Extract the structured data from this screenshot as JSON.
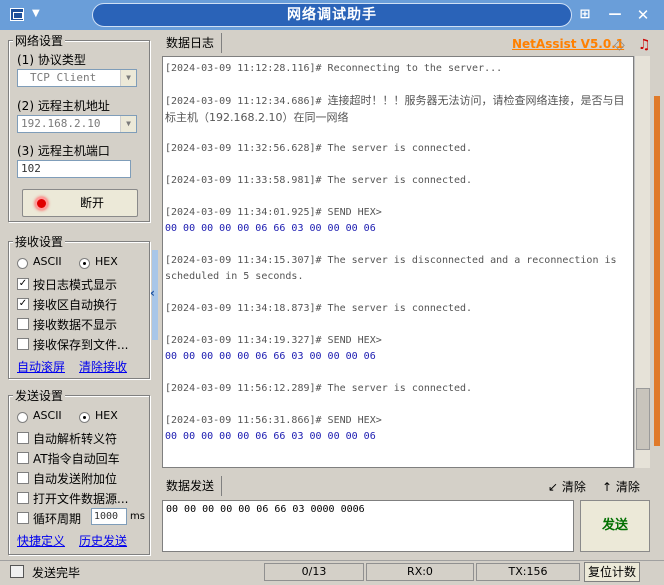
{
  "window": {
    "title": "网络调试助手"
  },
  "header": {
    "log_tab": "数据日志",
    "brand": "NetAssist V5.0.1"
  },
  "network": {
    "title": "网络设置",
    "protocol_label": "(1) 协议类型",
    "protocol_value": "TCP Client",
    "host_label": "(2) 远程主机地址",
    "host_value": "192.168.2.10",
    "port_label": "(3) 远程主机端口",
    "port_value": "102",
    "disconnect_label": "断开"
  },
  "receive": {
    "title": "接收设置",
    "ascii": "ASCII",
    "hex": "HEX",
    "options": [
      {
        "label": "按日志模式显示",
        "checked": true
      },
      {
        "label": "接收区自动换行",
        "checked": true
      },
      {
        "label": "接收数据不显示",
        "checked": false
      },
      {
        "label": "接收保存到文件...",
        "checked": false
      }
    ],
    "auto_scroll": "自动滚屏",
    "clear_receive": "清除接收"
  },
  "send": {
    "title": "发送设置",
    "ascii": "ASCII",
    "hex": "HEX",
    "options": [
      {
        "label": "自动解析转义符",
        "checked": false
      },
      {
        "label": "AT指令自动回车",
        "checked": false
      },
      {
        "label": "自动发送附加位",
        "checked": false
      },
      {
        "label": "打开文件数据源...",
        "checked": false
      },
      {
        "label": "循环周期",
        "checked": false
      }
    ],
    "period_value": "1000",
    "period_unit": "ms",
    "quick_define": "快捷定义",
    "history_send": "历史发送"
  },
  "log": [
    {
      "meta": "[2024-03-09 11:12:28.116]# Reconnecting to the server...",
      "text": ""
    },
    {
      "meta": "[2024-03-09 11:12:34.686]# ",
      "cn": "连接超时！！！服务器无法访问，请检查网络连接，是否与目标主机（192.168.2.10）在同一网络"
    },
    {
      "meta": "[2024-03-09 11:32:56.628]# The server is connected.",
      "text": ""
    },
    {
      "meta": "[2024-03-09 11:33:58.981]# The server is connected.",
      "text": ""
    },
    {
      "meta": "[2024-03-09 11:34:01.925]# SEND HEX>",
      "hex": "00 00 00 00 00 06 66 03 00 00 00 06"
    },
    {
      "meta": "[2024-03-09 11:34:15.307]# The server is disconnected and a reconnection is scheduled in 5 seconds.",
      "text": ""
    },
    {
      "meta": "[2024-03-09 11:34:18.873]# The server is connected.",
      "text": ""
    },
    {
      "meta": "[2024-03-09 11:34:19.327]# SEND HEX>",
      "hex": "00 00 00 00 00 06 66 03 00 00 00 06"
    },
    {
      "meta": "[2024-03-09 11:56:12.289]# The server is connected.",
      "text": ""
    },
    {
      "meta": "[2024-03-09 11:56:31.866]# SEND HEX>",
      "hex": "00 00 00 00 00 06 66 03 00 00 00 06"
    }
  ],
  "send_panel": {
    "tab": "数据发送",
    "clear_left": "清除",
    "clear_right": "清除",
    "content": "00 00 00 00 00 06 66 03 0000 0006",
    "send_button": "发送"
  },
  "status": {
    "message": "发送完毕",
    "counter": "0/13",
    "rx": "RX:0",
    "tx": "TX:156",
    "reset": "复位计数"
  },
  "colors": {
    "title_bar": "#6a9ed9",
    "title_pill": "#2a63b8",
    "brand": "#ff8000",
    "link": "#0000ee",
    "hex_text": "#1a1ab0",
    "send_button_text": "#007000"
  }
}
